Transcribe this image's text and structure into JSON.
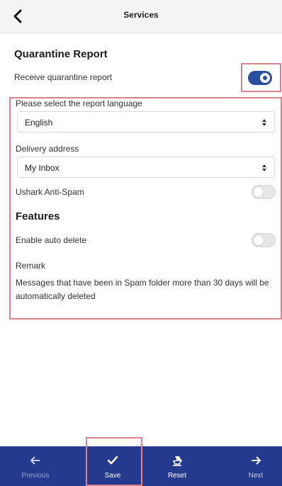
{
  "header": {
    "title": "Services"
  },
  "quarantine": {
    "title": "Quarantine Report",
    "receive_label": "Receive quarantine report",
    "receive_enabled": true
  },
  "report_language": {
    "label": "Please select the report language",
    "selected": "English"
  },
  "delivery_address": {
    "label": "Delivery address",
    "selected": "My Inbox"
  },
  "anti_spam": {
    "label": "Ushark Anti-Spam",
    "enabled": false
  },
  "features": {
    "title": "Features",
    "auto_delete_label": "Enable auto delete",
    "auto_delete_enabled": false,
    "remark_label": "Remark",
    "remark_text": "Messages that have been in Spam folder more than 30 days will be automatically deleted"
  },
  "footer": {
    "previous": "Previous",
    "save": "Save",
    "reset": "Reset",
    "next": "Next"
  },
  "colors": {
    "accent": "#2a4f9e",
    "footer_bg": "#253a8e",
    "highlight": "#d9838e"
  },
  "icons": {
    "back": "chevron-left-icon",
    "previous": "arrow-left-icon",
    "save": "checkmark-icon",
    "reset": "eraser-icon",
    "next": "arrow-right-icon",
    "select": "updown-arrows-icon"
  }
}
